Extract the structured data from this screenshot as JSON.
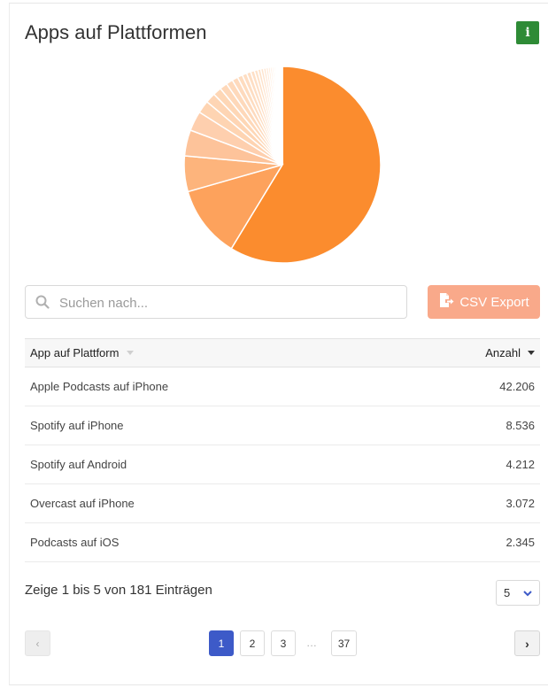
{
  "card": {
    "title": "Apps auf Plattformen",
    "info_label": "i"
  },
  "chart_data": {
    "type": "pie",
    "colors": [
      "#fb8c2e",
      "#fda25c",
      "#fdb47c",
      "#fdc39a",
      "#fecfae"
    ],
    "values": [
      42206,
      8536,
      4212,
      3072,
      2345,
      1500,
      1200,
      1000,
      900,
      800,
      700,
      600,
      550,
      500,
      450,
      400,
      360,
      330,
      300,
      270,
      240,
      220,
      200,
      180,
      160,
      140,
      120,
      100,
      90,
      80,
      70,
      60
    ]
  },
  "search": {
    "placeholder": "Suchen nach..."
  },
  "export": {
    "label": "CSV Export"
  },
  "table": {
    "columns": [
      "App auf Plattform",
      "Anzahl"
    ],
    "rows": [
      {
        "name": "Apple Podcasts auf iPhone",
        "count": "42.206"
      },
      {
        "name": "Spotify auf iPhone",
        "count": "8.536"
      },
      {
        "name": "Spotify auf Android",
        "count": "4.212"
      },
      {
        "name": "Overcast auf iPhone",
        "count": "3.072"
      },
      {
        "name": "Podcasts auf iOS",
        "count": "2.345"
      }
    ]
  },
  "pagination": {
    "info": "Zeige 1 bis 5 von 181 Einträgen",
    "page_length": "5",
    "prev": "‹",
    "next": "›",
    "pages": [
      "1",
      "2",
      "3",
      "37"
    ],
    "ellipsis": "…",
    "current_page": "1"
  },
  "colors": {
    "accent": "#3d5ac8",
    "info_button": "#2e8b36",
    "export_button": "#f9a98a"
  }
}
